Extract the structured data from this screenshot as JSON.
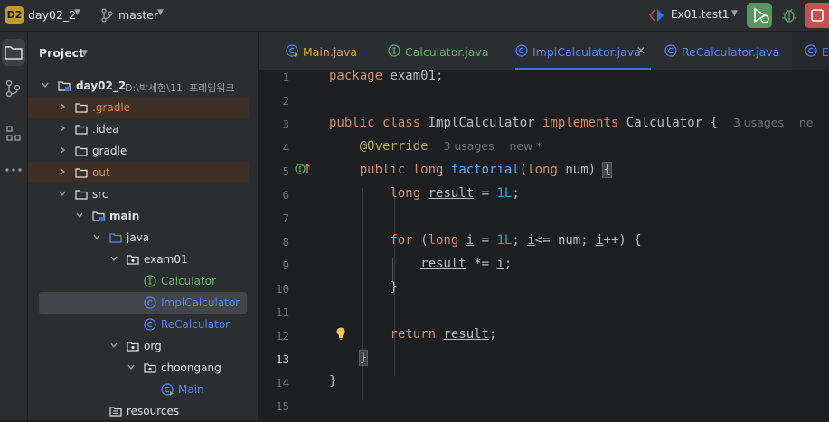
{
  "titlebar": {
    "project_badge": "D2",
    "project_name": "day02_2",
    "branch_name": "master",
    "run_config": "Ex01.test1"
  },
  "project_panel": {
    "title": "Project",
    "root_label": "day02_2",
    "root_path": "D:\\박세현\\11. 프레임워크",
    "items": [
      {
        "label": "day02_2"
      },
      {
        "label": ".gradle"
      },
      {
        "label": ".idea"
      },
      {
        "label": "gradle"
      },
      {
        "label": "out"
      },
      {
        "label": "src"
      },
      {
        "label": "main"
      },
      {
        "label": "java"
      },
      {
        "label": "exam01"
      },
      {
        "label": "Calculator"
      },
      {
        "label": "ImplCalculator"
      },
      {
        "label": "ReCalculator"
      },
      {
        "label": "org"
      },
      {
        "label": "choongang"
      },
      {
        "label": "Main"
      },
      {
        "label": "resources"
      }
    ]
  },
  "tabs": [
    {
      "label": "Main.java"
    },
    {
      "label": "Calculator.java"
    },
    {
      "label": "ImplCalculator.java"
    },
    {
      "label": "ReCalculator.java"
    },
    {
      "label": "Ex"
    }
  ],
  "editor": {
    "line_numbers": [
      "1",
      "2",
      "3",
      "4",
      "5",
      "6",
      "7",
      "8",
      "9",
      "10",
      "11",
      "12",
      "13",
      "14",
      "15"
    ],
    "current_line": "13",
    "hints": {
      "class_usages": "3 usages",
      "class_new": "ne",
      "override_usages": "3 usages",
      "override_new": "new *"
    },
    "tokens": {
      "package": "package",
      "package_name": " exam01;",
      "public": "public",
      "class": "class",
      "class_name": "ImplCalculator",
      "implements": "implements",
      "iface": "Calculator",
      "open_brace": "{",
      "override": "@Override",
      "long": "long",
      "method": "factorial",
      "params_open": "(",
      "param_name": " num) ",
      "result": "result",
      "assign": " = ",
      "one_l": "1L",
      "semi": ";",
      "for": "for",
      "for_open": " (",
      "i": "i",
      "le": "<= num; ",
      "inc": "++) {",
      "mul_assign": " *= ",
      "close_brace": "}",
      "return": "return"
    }
  },
  "colors": {
    "accent": "#3574f0",
    "run": "#57965c",
    "stop": "#c94f4f",
    "keyword": "#cf8e6d",
    "function": "#56a8f5",
    "number": "#2aacb8",
    "annotation": "#b3ae60"
  }
}
